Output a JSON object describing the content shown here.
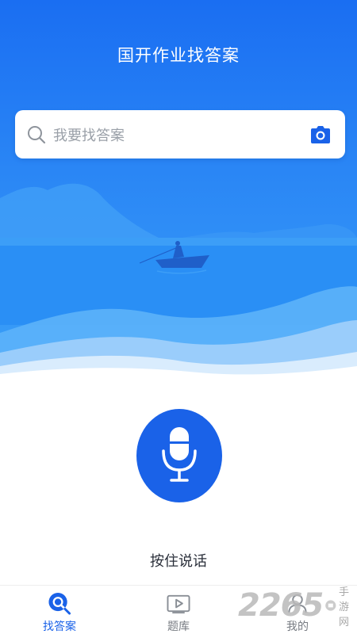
{
  "header": {
    "title": "国开作业找答案"
  },
  "search": {
    "placeholder": "我要找答案",
    "search_icon": "search-icon",
    "camera_icon": "camera-icon"
  },
  "voice": {
    "label": "按住说话",
    "icon": "microphone-icon"
  },
  "tabbar": {
    "items": [
      {
        "label": "找答案",
        "icon": "search-icon",
        "active": true
      },
      {
        "label": "题库",
        "icon": "play-icon",
        "active": false
      },
      {
        "label": "我的",
        "icon": "user-icon",
        "active": false
      }
    ]
  },
  "watermark": {
    "number": "2265",
    "text": "手游网"
  },
  "colors": {
    "primary": "#1a62e8",
    "hero_top": "#1a6ef2",
    "hero_bottom": "#3aa0f8",
    "inactive_tab": "#777b82",
    "placeholder": "#9aa0a8"
  }
}
